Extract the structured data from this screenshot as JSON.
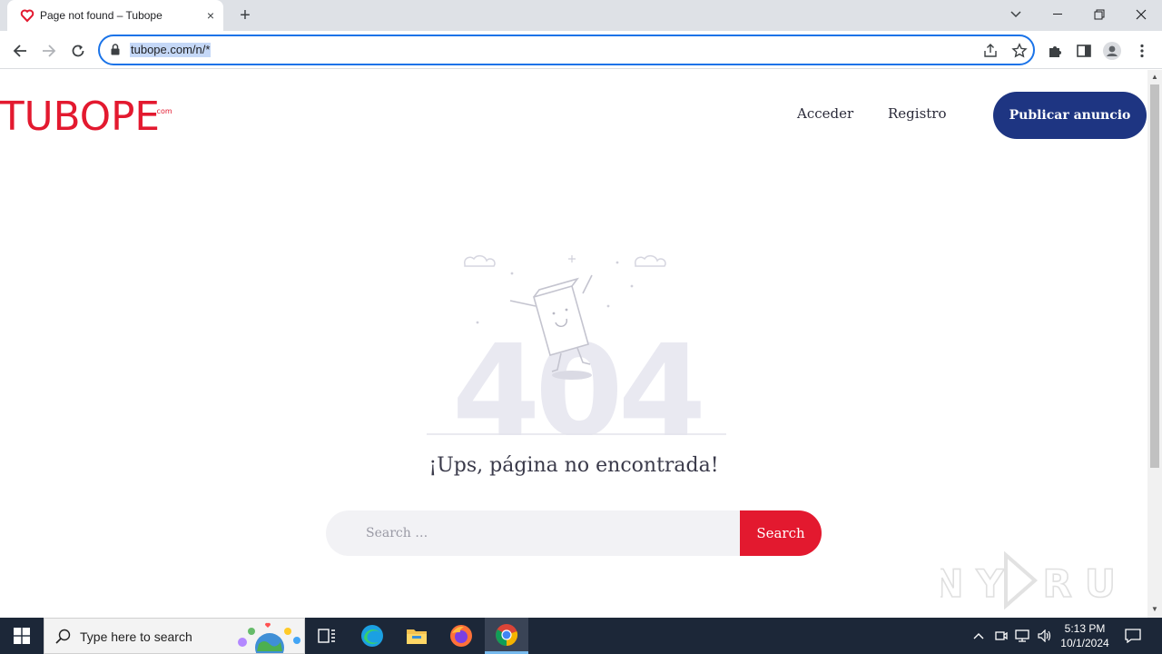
{
  "browser": {
    "tab_title": "Page not found – Tubope",
    "tab_close": "×",
    "new_tab": "+",
    "url": "tubope.com/n/*"
  },
  "site": {
    "logo_text": "TUBOPE",
    "logo_suffix": ".com",
    "nav": {
      "login": "Acceder",
      "register": "Registro"
    },
    "publish_button": "Publicar anuncio"
  },
  "error": {
    "illustration_number": "404",
    "headline": "¡Ups, página no encontrada!"
  },
  "search": {
    "placeholder": "Search …",
    "button": "Search"
  },
  "watermark": "ANY RUN",
  "taskbar": {
    "search_placeholder": "Type here to search",
    "time": "5:13 PM",
    "date": "10/1/2024"
  },
  "colors": {
    "brand_red": "#e3192f",
    "brand_blue": "#1e3582",
    "omnibox_focus": "#1a73e8",
    "taskbar_bg": "#1c2738"
  },
  "icons": {
    "favicon": "tubope-heart-icon",
    "back": "arrow-left-icon",
    "forward": "arrow-right-icon",
    "reload": "reload-icon",
    "lock": "lock-icon",
    "share": "share-icon",
    "bookmark": "star-icon",
    "extensions": "puzzle-icon",
    "sidepanel": "side-panel-icon",
    "profile": "profile-icon",
    "menu": "kebab-menu-icon"
  }
}
